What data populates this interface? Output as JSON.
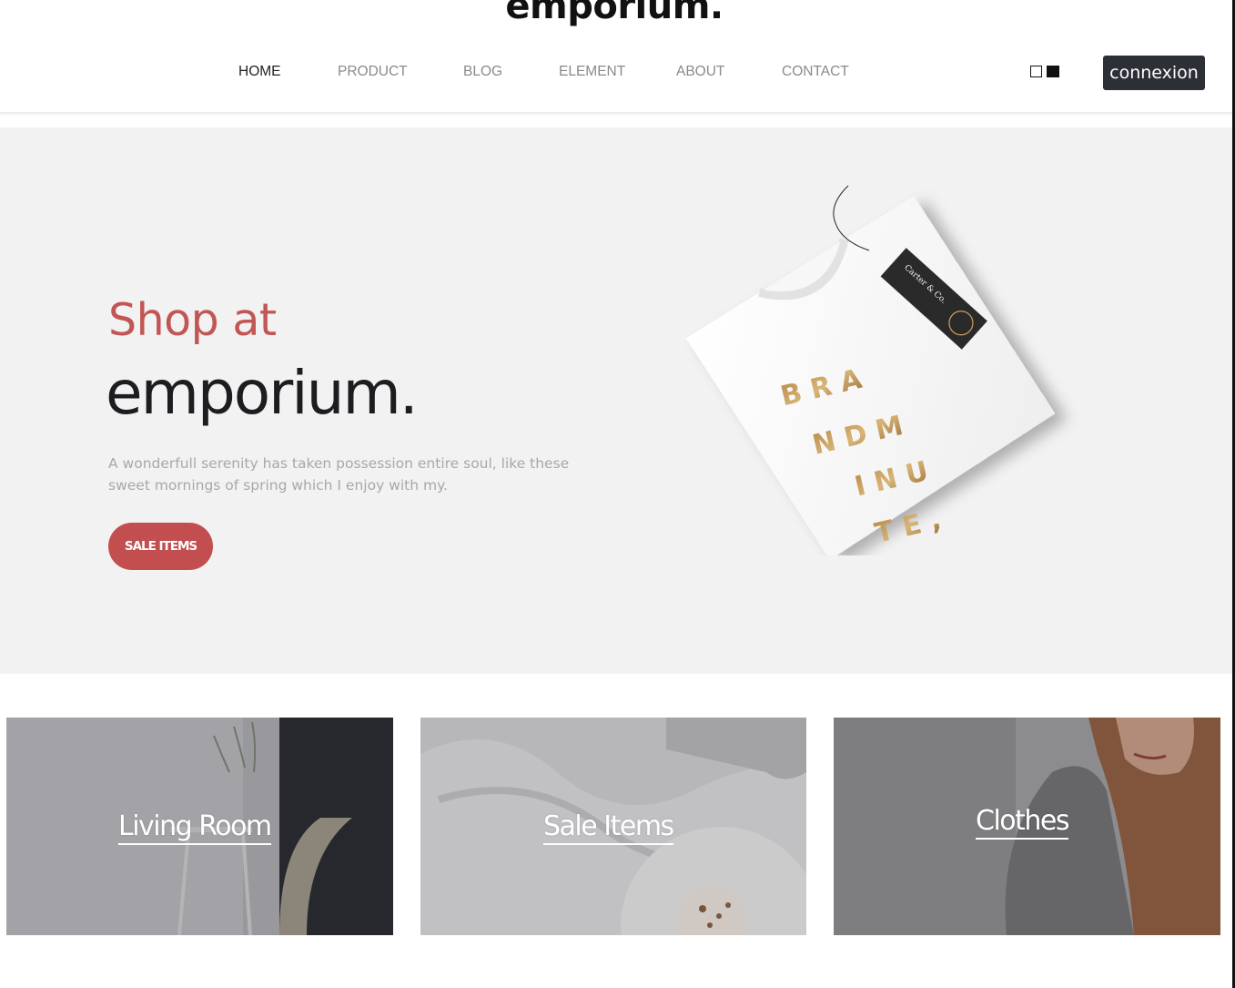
{
  "header": {
    "logo": "emporium.",
    "nav": [
      {
        "label": "HOME",
        "active": true
      },
      {
        "label": "PRODUCT",
        "active": false
      },
      {
        "label": "BLOG",
        "active": false
      },
      {
        "label": "ELEMENT",
        "active": false
      },
      {
        "label": "ABOUT",
        "active": false
      },
      {
        "label": "CONTACT",
        "active": false
      }
    ],
    "theme_switch_icons": [
      "light-square-icon",
      "dark-square-icon"
    ],
    "login_label": "connexion"
  },
  "hero": {
    "pre_title": "Shop at",
    "title": "emporium.",
    "description": "A wonderfull serenity has taken possession entire soul, like these sweet mornings of spring which I enjoy with my.",
    "button_label": "SALE ITEMS",
    "shirt_print": [
      "B R A",
      "N D   M",
      "I   N U",
      "T E ,"
    ],
    "tag_brand": "Carter & Co.",
    "tag_sub": "BRA NDMIN UTE"
  },
  "categories": [
    {
      "label": "Living Room"
    },
    {
      "label": "Sale Items"
    },
    {
      "label": "Clothes"
    }
  ],
  "colors": {
    "accent": "#c24e50",
    "pre_title": "#c25654",
    "dark": "#1c1d20",
    "hero_bg": "#f3f2f2",
    "login_bg": "#2c3036"
  }
}
